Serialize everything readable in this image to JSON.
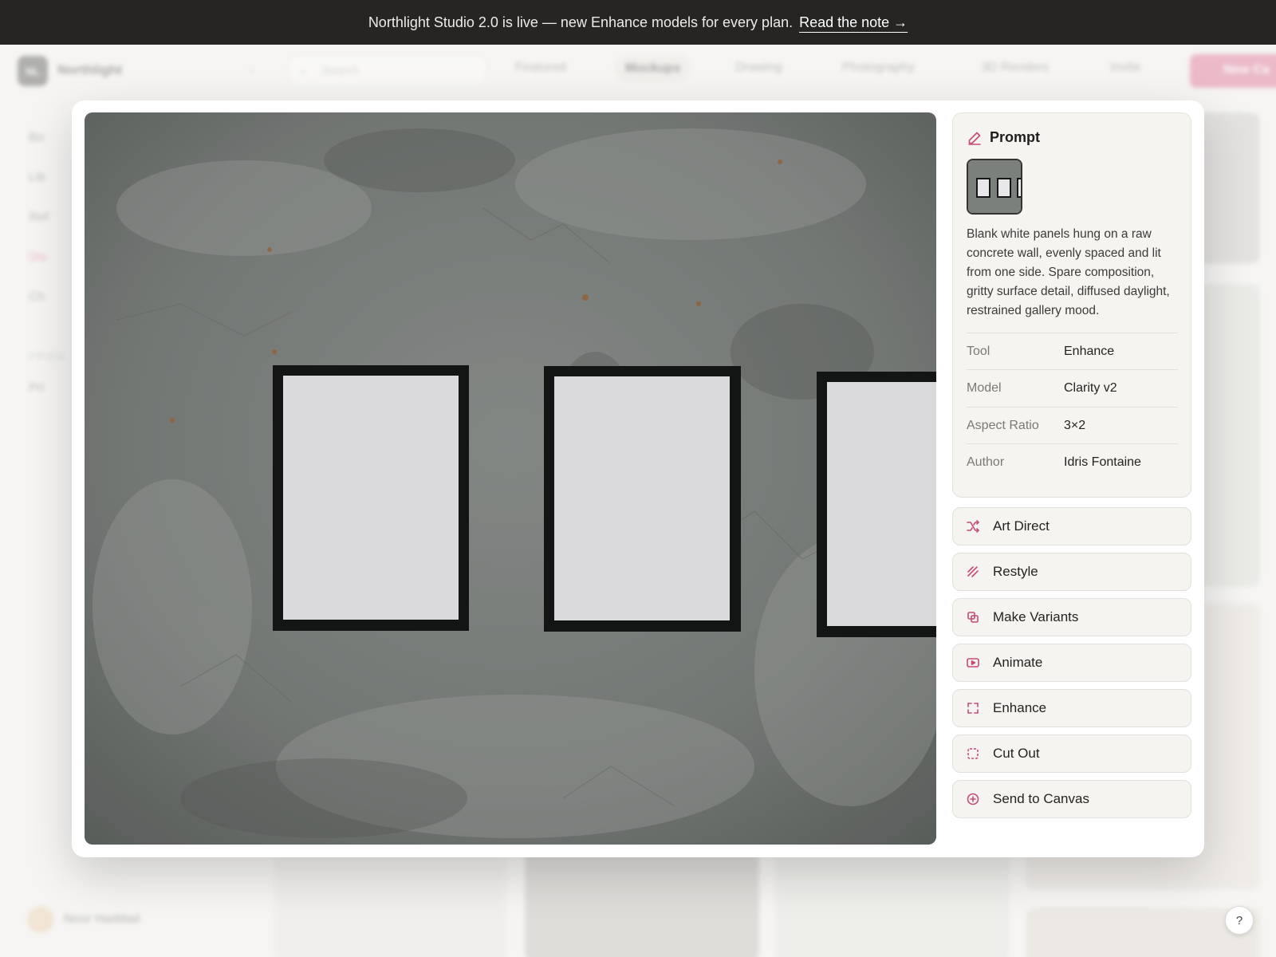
{
  "announcement": {
    "text": "Northlight Studio 2.0 is live — new Enhance models for every plan.",
    "link": "Read the note →"
  },
  "background": {
    "workspace": {
      "initials": "NL",
      "name": "Northlight"
    },
    "search_placeholder": "Search",
    "categories": [
      "Featured",
      "Mockups",
      "Drawing",
      "Photography",
      "3D Renders"
    ],
    "invite_label": "Invite",
    "new_canvas_label": "New Ca",
    "sidebar_items": [
      "Bo",
      "Lib",
      "Ref",
      "Dis",
      "Ch"
    ],
    "sidebar_section": "FRIEN",
    "sidebar_extra": "Pri",
    "user_name": "Noor Haddad"
  },
  "modal": {
    "prompt": {
      "heading": "Prompt",
      "text": "Blank white panels hung on a raw concrete wall, evenly spaced and lit from one side. Spare composition, gritty surface detail, diffused daylight, restrained gallery mood."
    },
    "meta": [
      {
        "key": "Tool",
        "value": "Enhance"
      },
      {
        "key": "Model",
        "value": "Clarity v2"
      },
      {
        "key": "Aspect Ratio",
        "value": "3×2"
      },
      {
        "key": "Author",
        "value": "Idris Fontaine"
      }
    ],
    "actions": [
      {
        "label": "Art Direct",
        "icon": "shuffle-icon"
      },
      {
        "label": "Restyle",
        "icon": "brush-stroke-icon"
      },
      {
        "label": "Make Variants",
        "icon": "copy-icon"
      },
      {
        "label": "Animate",
        "icon": "play-icon"
      },
      {
        "label": "Enhance",
        "icon": "expand-corners-icon"
      },
      {
        "label": "Cut Out",
        "icon": "dashed-square-icon"
      },
      {
        "label": "Send to Canvas",
        "icon": "plus-circle-icon"
      }
    ]
  },
  "help_label": "?",
  "colors": {
    "accent": "#d86189",
    "announcement_bg": "#262523",
    "panel_bg": "#f5f4f1"
  }
}
